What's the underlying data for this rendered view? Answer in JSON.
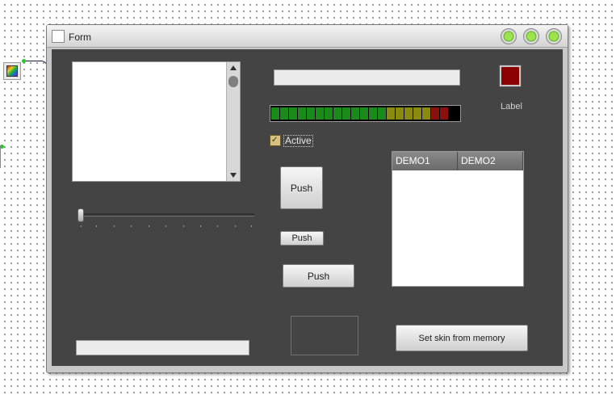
{
  "window": {
    "title": "Form",
    "title_buttons": [
      "minimize-button",
      "maximize-button",
      "close-button"
    ]
  },
  "controls": {
    "checkbox_label": "Active",
    "push_button_1": "Push",
    "push_button_2": "Push",
    "push_button_3": "Push",
    "label": "Label",
    "skin_button": "Set skin from memory"
  },
  "listview": {
    "columns": [
      "DEMO1",
      "DEMO2"
    ]
  },
  "slider": {
    "value": 0
  },
  "colors": {
    "client_bg": "#444444",
    "swatch": "#8b0000"
  }
}
